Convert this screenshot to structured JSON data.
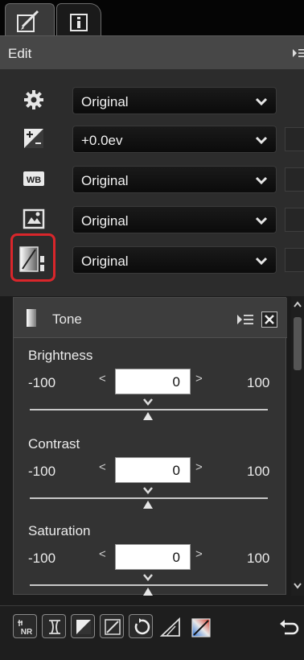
{
  "edit": {
    "header_label": "Edit",
    "rows": [
      {
        "icon": "gear-icon",
        "value": "Original"
      },
      {
        "icon": "exposure-compensation-icon",
        "value": "+0.0ev"
      },
      {
        "icon": "white-balance-icon",
        "value": "Original"
      },
      {
        "icon": "picture-control-icon",
        "value": "Original"
      },
      {
        "icon": "tone-icon",
        "value": "Original"
      }
    ]
  },
  "tone": {
    "title": "Tone",
    "sliders": [
      {
        "name": "Brightness",
        "min": "-100",
        "max": "100",
        "value": "0"
      },
      {
        "name": "Contrast",
        "min": "-100",
        "max": "100",
        "value": "0"
      },
      {
        "name": "Saturation",
        "min": "-100",
        "max": "100",
        "value": "0"
      }
    ]
  },
  "toolbar": {
    "items": [
      "noise-reduction-icon",
      "lens-correction-icon",
      "tone-curve-icon",
      "tone-icon",
      "rotate-icon",
      "straighten-icon",
      "color-adjust-icon",
      "undo-icon"
    ],
    "nr_label": "NR"
  },
  "colors": {
    "highlight": "#d9262b"
  }
}
